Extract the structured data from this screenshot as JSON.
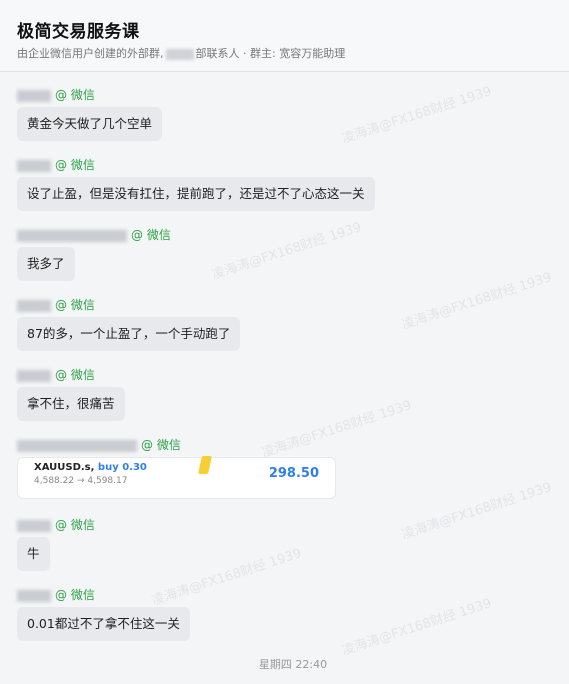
{
  "header": {
    "title": "极简交易服务课",
    "subtitle_prefix": "由企业微信用户创建的外部群,",
    "subtitle_suffix": "部联系人 · 群主: 宽容万能助理"
  },
  "sender_suffix": "@ 微信",
  "messages": [
    {
      "text": "黄金今天做了几个空单"
    },
    {
      "text": "设了止盈，但是没有扛住，提前跑了，还是过不了心态这一关"
    },
    {
      "text": "我多了"
    },
    {
      "text": "87的多，一个止盈了，一个手动跑了"
    },
    {
      "text": "拿不住，很痛苦"
    },
    {
      "card": {
        "symbol": "XAUUSD.s,",
        "side": "buy 0.30",
        "open_price": "4,588.22",
        "arrow": "→",
        "close_price": "4,598.17",
        "profit": "298.50"
      }
    },
    {
      "text": "牛"
    },
    {
      "text": "0.01都过不了拿不住这一关"
    }
  ],
  "timestamp": "星期四 22:40",
  "watermark": "凌海涛@FX168财经 1939"
}
